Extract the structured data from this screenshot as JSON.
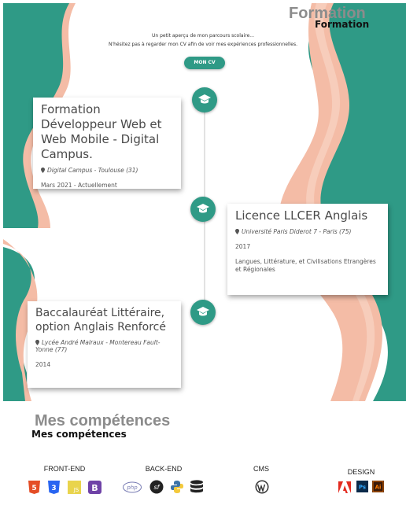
{
  "formation": {
    "title": "Formation",
    "intro_line1": "Un petit aperçu de mon parcours scolaire...",
    "intro_line2": "N'hésitez pas à regarder mon CV afin de voir mes expériences professionnelles.",
    "cv_button": "MON CV",
    "items": [
      {
        "title": "Formation Développeur Web et Web Mobile - Digital Campus.",
        "location": "Digital Campus - Toulouse (31)",
        "date": "Mars 2021 - Actuellement",
        "icon": "graduation-cap-icon"
      },
      {
        "title": "Licence LLCER Anglais",
        "location": "Université Paris Diderot 7 - Paris (75)",
        "date": "2017",
        "description": "Langues, Littérature, et Civilisations Etrangères et Régionales",
        "icon": "graduation-cap-icon"
      },
      {
        "title": "Baccalauréat Littéraire, option Anglais Renforcé",
        "location": "Lycée André Malraux - Montereau Fault-Yonne (77)",
        "date": "2014",
        "icon": "graduation-cap-icon"
      }
    ]
  },
  "skills": {
    "title": "Mes compétences",
    "categories": [
      {
        "label": "FRONT-END",
        "icons": [
          "html5-icon",
          "css3-icon",
          "js-icon",
          "bootstrap-icon"
        ]
      },
      {
        "label": "BACK-END",
        "icons": [
          "php-icon",
          "symfony-icon",
          "python-icon",
          "database-icon"
        ]
      },
      {
        "label": "CMS",
        "icons": [
          "wordpress-icon"
        ]
      },
      {
        "label": "DESIGN",
        "icons": [
          "adobe-icon",
          "photoshop-icon",
          "illustrator-icon"
        ]
      }
    ],
    "icon_text": {
      "js": "JS",
      "bootstrap": "B",
      "php": "php",
      "symfony": "sf",
      "photoshop": "Ps",
      "illustrator": "Ai"
    }
  },
  "colors": {
    "teal": "#2f9a86",
    "peach": "#f4bca6",
    "html5": "#e44d26",
    "css3": "#2965f1",
    "js": "#e9d44d",
    "bootstrap": "#6f42a7"
  }
}
